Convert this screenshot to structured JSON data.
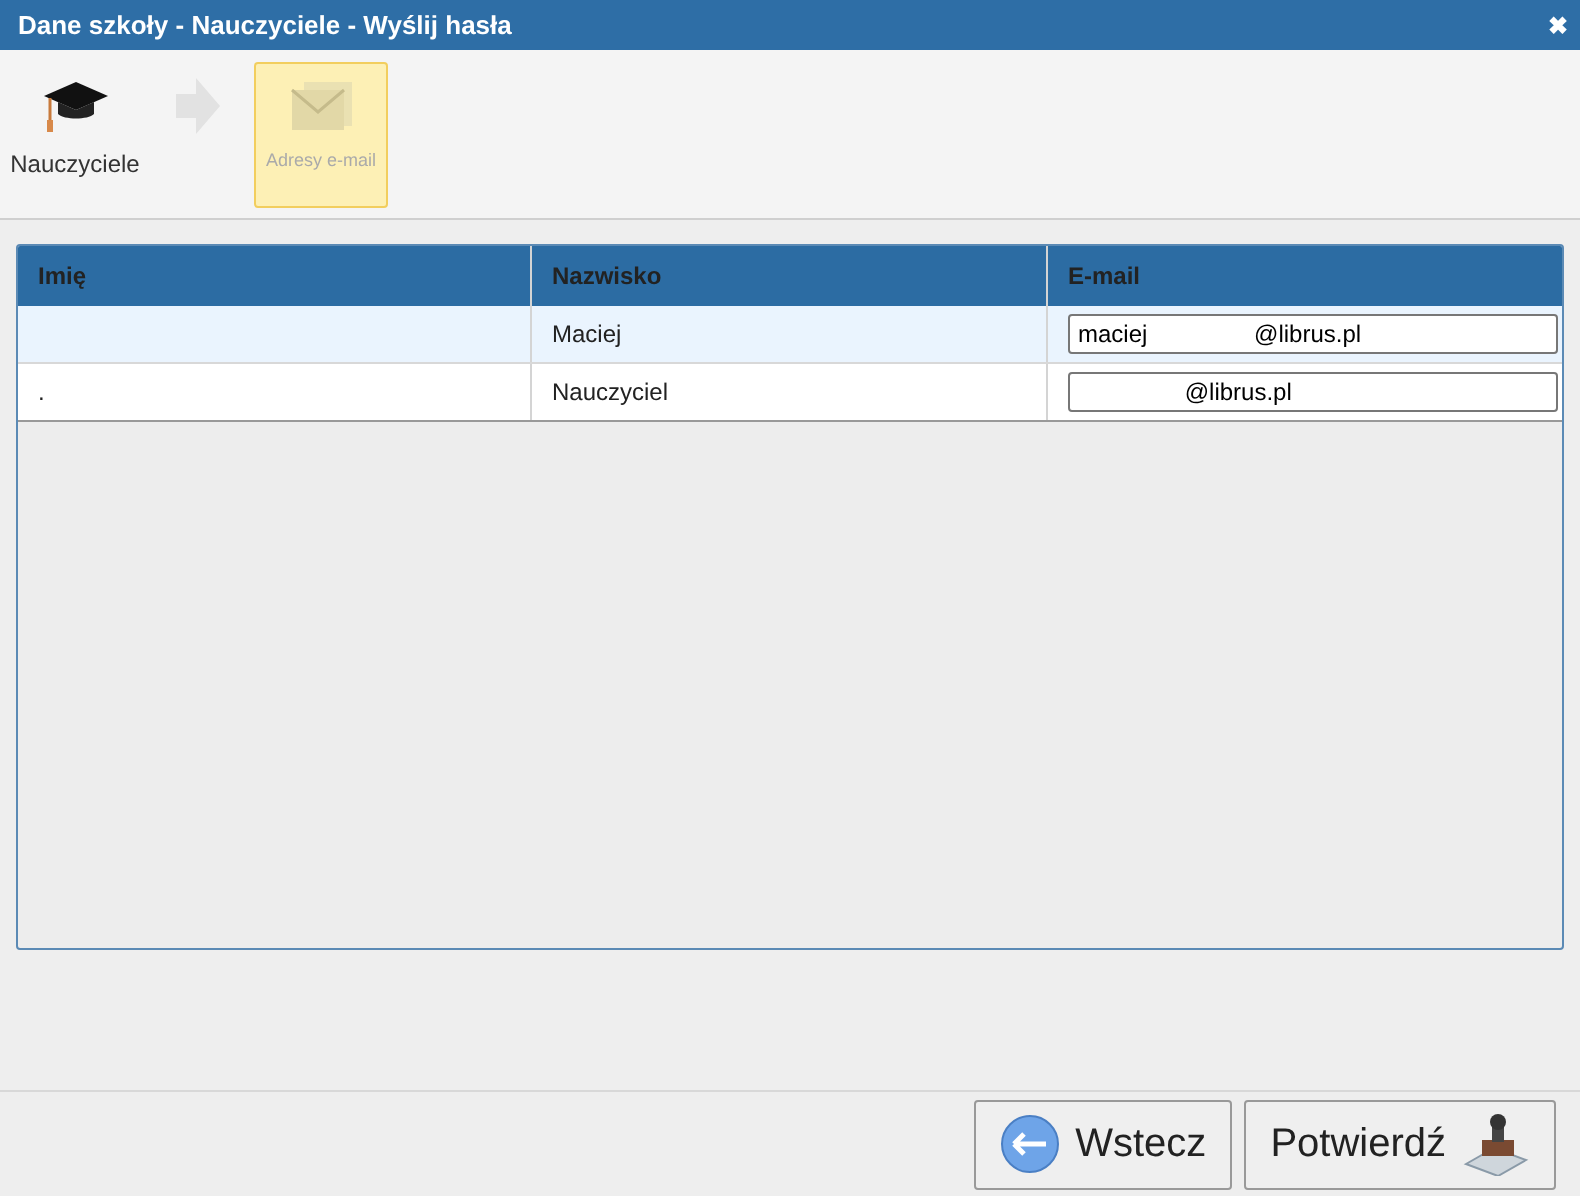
{
  "window": {
    "title": "Dane szkoły - Nauczyciele - Wyślij hasła",
    "close": "✖"
  },
  "steps": [
    {
      "kind": "cap",
      "label": "Nauczyciele",
      "selected": false,
      "disabled": false
    },
    {
      "kind": "arrow"
    },
    {
      "kind": "mail",
      "label": "Adresy e-mail",
      "selected": true,
      "disabled": true
    }
  ],
  "table": {
    "columns": [
      "Imię",
      "Nazwisko",
      "E-mail"
    ],
    "rows": [
      {
        "first_name": "",
        "last_name": "Maciej",
        "email": "maciej                @librus.pl",
        "selected": true
      },
      {
        "first_name": ".",
        "last_name": "Nauczyciel",
        "email": "                @librus.pl",
        "selected": false
      }
    ]
  },
  "buttons": [
    {
      "kind": "back",
      "label": "Wstecz"
    },
    {
      "kind": "confirm",
      "label": "Potwierdź"
    }
  ]
}
